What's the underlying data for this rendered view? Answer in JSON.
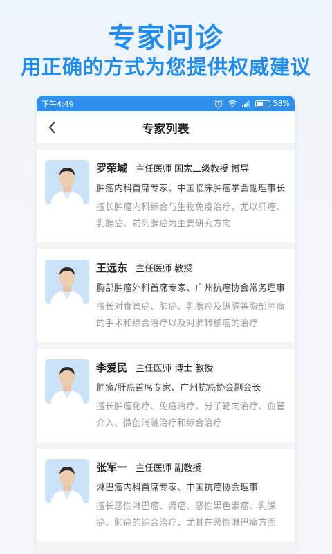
{
  "promo": {
    "title": "专家问诊",
    "subtitle": "用正确的方式为您提供权威建议"
  },
  "status_bar": {
    "time": "下午4:49",
    "battery": "58%",
    "battery_level": 0.58,
    "icons": [
      "alarm-icon",
      "wifi-icon",
      "signal-icon",
      "battery-icon"
    ]
  },
  "header": {
    "title": "专家列表",
    "back_icon": "chevron-left-icon"
  },
  "doctors": [
    {
      "name": "罗荣城",
      "title": "主任医师  国家二级教授 博导",
      "desc": "肿瘤内科首席专家、中国临床肿瘤学会副理事长",
      "specialty": "擅长肿瘤内科综合与生物免疫治疗，尤以肝癌、乳腺癌、前列腺癌为主要研究方向"
    },
    {
      "name": "王远东",
      "title": "主任医师  教授",
      "desc": "胸部肿瘤外科首席专家、广州抗癌协会常务理事",
      "specialty": "擅长对食管癌、肺癌、乳腺癌及纵膈等胸部肿瘤的手术和综合治疗以及对肺转移瘤的治疗"
    },
    {
      "name": "李爱民",
      "title": "主任医师  博士  教授",
      "desc": "肿瘤/肝癌首席专家、广州抗癌协会副会长",
      "specialty": "擅长肿瘤化疗、免疫治疗、分子靶向治疗、血管介入、微创消融治疗和综合治疗"
    },
    {
      "name": "张军一",
      "title": "主任医师  副教授",
      "desc": "淋巴瘤内科首席专家、中国抗癌协会理事",
      "specialty": "擅长恶性淋巴瘤、肾癌、恶性黑色素瘤、乳腺癌、肺癌的综合治疗，尤其在恶性淋巴瘤方面"
    }
  ],
  "colors": {
    "accent": "#1e8cf0",
    "status_bar": "#2f8eec"
  }
}
